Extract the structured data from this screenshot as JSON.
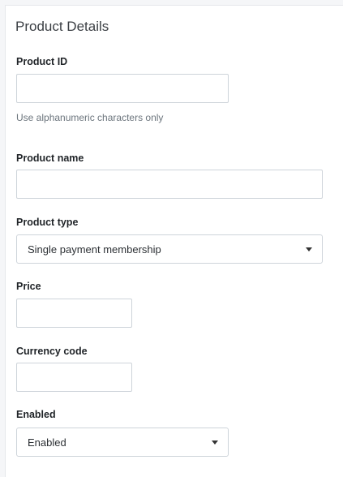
{
  "section": {
    "title": "Product Details"
  },
  "fields": {
    "product_id": {
      "label": "Product ID",
      "value": "",
      "help": "Use alphanumeric characters only"
    },
    "product_name": {
      "label": "Product name",
      "value": ""
    },
    "product_type": {
      "label": "Product type",
      "selected": "Single payment membership"
    },
    "price": {
      "label": "Price",
      "value": ""
    },
    "currency_code": {
      "label": "Currency code",
      "value": ""
    },
    "enabled": {
      "label": "Enabled",
      "selected": "Enabled"
    }
  },
  "icons": {
    "dropdown": "chevron-down-icon"
  }
}
